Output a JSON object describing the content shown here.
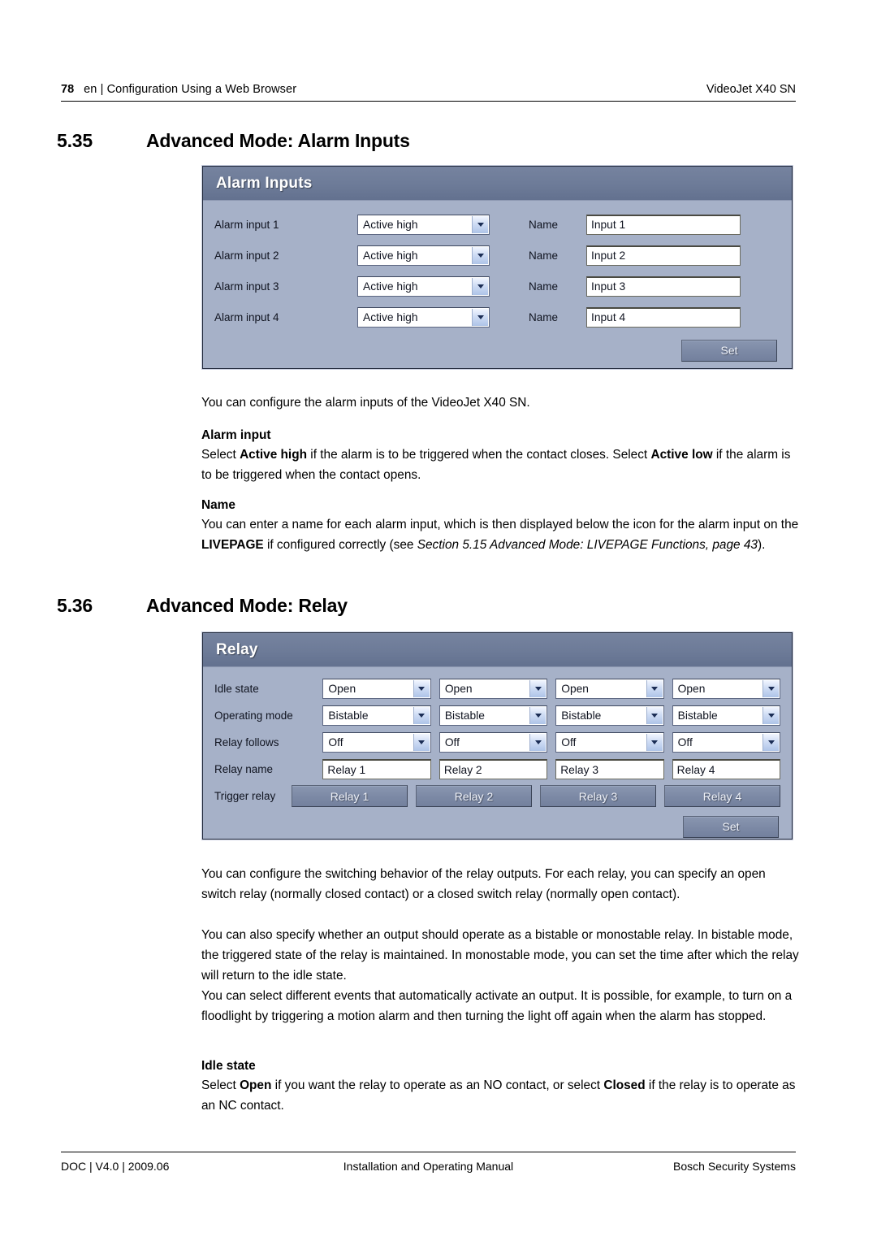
{
  "header": {
    "page_number": "78",
    "breadcrumb": "en | Configuration Using a Web Browser",
    "product": "VideoJet X40 SN"
  },
  "sections": [
    {
      "number": "5.35",
      "title": "Advanced Mode: Alarm Inputs"
    },
    {
      "number": "5.36",
      "title": "Advanced Mode: Relay"
    }
  ],
  "alarm_panel": {
    "title": "Alarm Inputs",
    "name_label": "Name",
    "set_label": "Set",
    "rows": [
      {
        "label": "Alarm input 1",
        "mode": "Active high",
        "name_label": "Name",
        "name_value": "Input 1"
      },
      {
        "label": "Alarm input 2",
        "mode": "Active high",
        "name_label": "Name",
        "name_value": "Input 2"
      },
      {
        "label": "Alarm input 3",
        "mode": "Active high",
        "name_label": "Name",
        "name_value": "Input 3"
      },
      {
        "label": "Alarm input 4",
        "mode": "Active high",
        "name_label": "Name",
        "name_value": "Input 4"
      }
    ]
  },
  "alarm_text": {
    "intro": "You can configure the alarm inputs of the VideoJet X40 SN.",
    "h1": "Alarm input",
    "p1_a": "Select ",
    "p1_b": "Active high",
    "p1_c": " if the alarm is to be triggered when the contact closes. Select ",
    "p1_d": "Active low",
    "p1_e": " if the alarm is to be triggered when the contact opens.",
    "h2": "Name",
    "p2_a": "You can enter a name for each alarm input, which is then displayed below the icon for the alarm input on the ",
    "p2_b": "LIVEPAGE",
    "p2_c": " if configured correctly (see ",
    "p2_d": "Section 5.15 Advanced Mode: LIVEPAGE Functions, page 43",
    "p2_e": ")."
  },
  "relay_panel": {
    "title": "Relay",
    "set_label": "Set",
    "row_labels": {
      "idle_state": "Idle state",
      "operating_mode": "Operating mode",
      "relay_follows": "Relay follows",
      "relay_name": "Relay name",
      "trigger_relay": "Trigger relay"
    },
    "columns": [
      {
        "idle_state": "Open",
        "operating_mode": "Bistable",
        "relay_follows": "Off",
        "relay_name": "Relay 1",
        "trigger_relay": "Relay 1"
      },
      {
        "idle_state": "Open",
        "operating_mode": "Bistable",
        "relay_follows": "Off",
        "relay_name": "Relay 2",
        "trigger_relay": "Relay 2"
      },
      {
        "idle_state": "Open",
        "operating_mode": "Bistable",
        "relay_follows": "Off",
        "relay_name": "Relay 3",
        "trigger_relay": "Relay 3"
      },
      {
        "idle_state": "Open",
        "operating_mode": "Bistable",
        "relay_follows": "Off",
        "relay_name": "Relay 4",
        "trigger_relay": "Relay 4"
      }
    ]
  },
  "relay_text": {
    "p1": "You can configure the switching behavior of the relay outputs. For each relay, you can specify an open switch relay (normally closed contact) or a closed switch relay (normally open contact).",
    "p2": "You can also specify whether an output should operate as a bistable or monostable relay. In bistable mode, the triggered state of the relay is maintained. In monostable mode, you can set the time after which the relay will return to the idle state.",
    "p3": "You can select different events that automatically activate an output. It is possible, for example, to turn on a floodlight by triggering a motion alarm and then turning the light off again when the alarm has stopped.",
    "h1": "Idle state",
    "p4_a": "Select ",
    "p4_b": "Open",
    "p4_c": " if you want the relay to operate as an NO contact, or select ",
    "p4_d": "Closed",
    "p4_e": " if the relay is to operate as an NC contact."
  },
  "footer": {
    "left": "DOC | V4.0 | 2009.06",
    "center": "Installation and Operating Manual",
    "right": "Bosch Security Systems"
  }
}
